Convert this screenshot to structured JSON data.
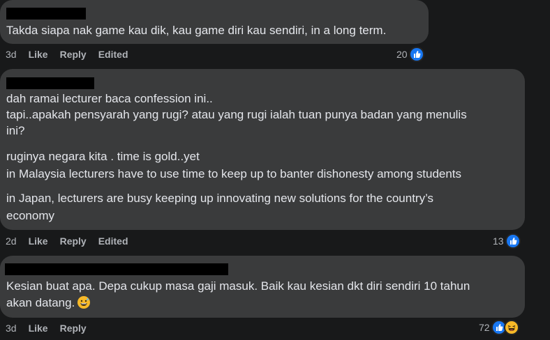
{
  "comments": [
    {
      "lines": [
        "Takda siapa nak game kau dik, kau game diri kau sendiri, in a long term."
      ],
      "time": "3d",
      "like_label": "Like",
      "reply_label": "Reply",
      "edited_label": "Edited",
      "reaction_count": "20"
    },
    {
      "lines": [
        "dah ramai lecturer baca confession ini..",
        "tapi..apakah pensyarah yang rugi? atau yang rugi ialah tuan punya badan yang menulis",
        "ini?",
        "ruginya negara kita . time is gold..yet",
        "in Malaysia lecturers have to use time to keep up to banter dishonesty among students",
        "in Japan, lecturers are busy keeping up innovating new solutions for the country’s",
        "economy"
      ],
      "time": "2d",
      "like_label": "Like",
      "reply_label": "Reply",
      "edited_label": "Edited",
      "reaction_count": "13"
    },
    {
      "lines": [
        "Kesian buat apa. Depa cukup masa gaji masuk. Baik kau kesian dkt diri sendiri 10 tahun",
        "akan datang."
      ],
      "time": "3d",
      "like_label": "Like",
      "reply_label": "Reply",
      "reaction_count": "72"
    }
  ],
  "colors": {
    "background": "#18191a",
    "bubble": "#3a3b3c",
    "text": "#e4e6eb",
    "meta": "#b0b3b8",
    "like_blue": "#1877f2",
    "haha_yellow": "#f7b928"
  },
  "icons": {
    "like": "thumbs-up-icon",
    "haha": "laughing-emoji-icon",
    "inline_emoji": "grinning-sweat-emoji-icon"
  }
}
